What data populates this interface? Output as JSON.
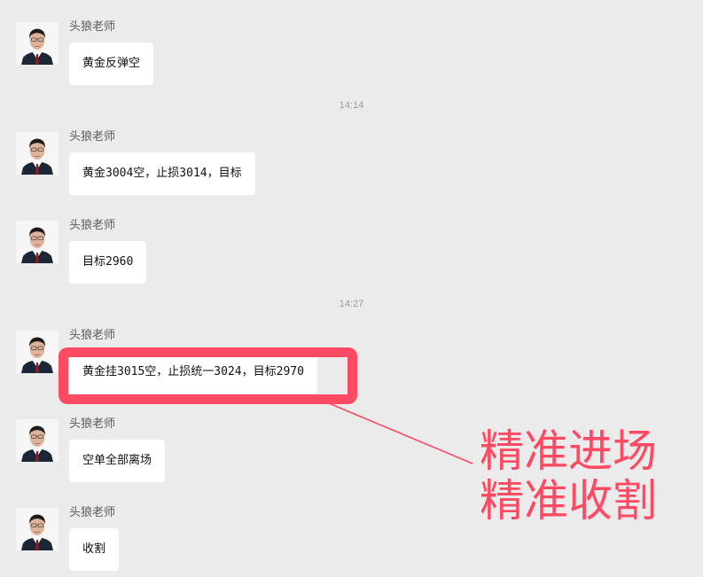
{
  "chat": {
    "sender_name": "头狼老师",
    "messages": [
      {
        "sender": "头狼老师",
        "text": "黄金反弹空"
      },
      {
        "sender": "头狼老师",
        "text": "黄金3004空，止损3014，目标"
      },
      {
        "sender": "头狼老师",
        "text": "目标2960"
      },
      {
        "sender": "头狼老师",
        "text": "黄金挂3015空，止损统一3024，目标2970"
      },
      {
        "sender": "头狼老师",
        "text": "空单全部离场"
      },
      {
        "sender": "头狼老师",
        "text": "收割"
      }
    ],
    "timestamps": [
      "14:14",
      "14:27"
    ]
  },
  "annotation": {
    "caption_lines": [
      "精准进场",
      "精准收割"
    ],
    "color": "#ff4a63"
  },
  "colors": {
    "background": "#ebebeb",
    "bubble": "#ffffff",
    "accent": "#ff4a63"
  }
}
